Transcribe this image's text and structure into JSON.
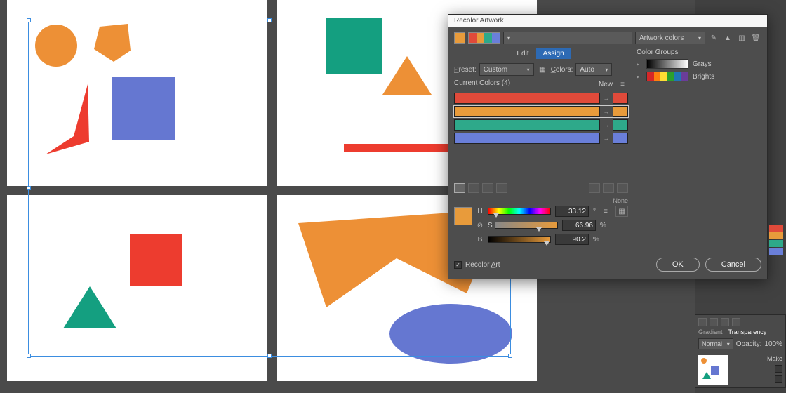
{
  "dialog": {
    "title": "Recolor Artwork",
    "artwork_colors_label": "Artwork colors",
    "tabs": {
      "edit": "Edit",
      "assign": "Assign"
    },
    "preset_label": "Preset:",
    "preset_value": "Custom",
    "colors_label": "Colors:",
    "colors_value": "Auto",
    "current_colors_header": "Current Colors (4)",
    "new_header": "New",
    "color_rows": [
      {
        "from": "#e04a3a",
        "to": "#e04a3a"
      },
      {
        "from": "#e89b3b",
        "to": "#e89b3b"
      },
      {
        "from": "#2ea98a",
        "to": "#2ea98a"
      },
      {
        "from": "#6a7fd9",
        "to": "#6a7fd9"
      }
    ],
    "none_label": "None",
    "color_groups_label": "Color Groups",
    "groups": {
      "grays": "Grays",
      "brights": "Brights"
    },
    "bright_colors": [
      "#d62728",
      "#ff7f0e",
      "#ffdd33",
      "#2ca02c",
      "#1f77b4",
      "#6a3d9a"
    ],
    "hsb": {
      "H_label": "H",
      "H_value": "33.12",
      "H_unit": "°",
      "S_label": "S",
      "S_value": "66.96",
      "S_unit": "%",
      "B_label": "B",
      "B_value": "90.2",
      "B_unit": "%"
    },
    "preview_swatch": "#e89b3b",
    "recolor_art_label": "Recolor Art",
    "recolor_art_checked": true,
    "ok": "OK",
    "cancel": "Cancel"
  },
  "side_panel": {
    "tab_gradient": "Gradient",
    "tab_transparency": "Transparency",
    "blend_mode": "Normal",
    "opacity_label": "Opacity:",
    "opacity_value": "100%",
    "make_label": "Make"
  },
  "shapes": {
    "orange": "#ed9036",
    "red": "#ed3c2f",
    "teal": "#149f80",
    "blue": "#6577d1"
  }
}
